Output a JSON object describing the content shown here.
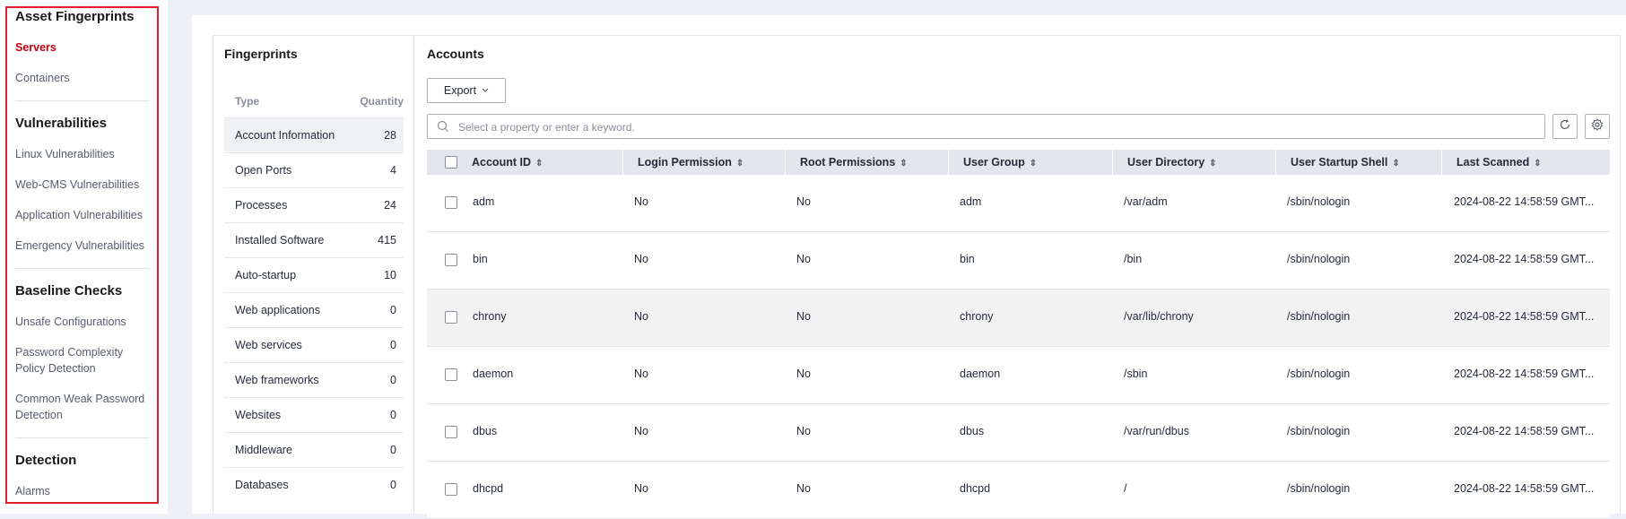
{
  "nav": {
    "groups": [
      {
        "title": "Asset Fingerprints",
        "items": [
          "Servers",
          "Containers"
        ]
      },
      {
        "title": "Vulnerabilities",
        "items": [
          "Linux Vulnerabilities",
          "Web-CMS Vulnerabilities",
          "Application Vulnerabilities",
          "Emergency Vulnerabilities"
        ]
      },
      {
        "title": "Baseline Checks",
        "items": [
          "Unsafe Configurations",
          "Password Complexity Policy Detection",
          "Common Weak Password Detection"
        ]
      },
      {
        "title": "Detection",
        "items": [
          "Alarms"
        ]
      }
    ],
    "active_item": "Servers",
    "highlight_color": "#e0202a"
  },
  "fingerprints": {
    "title": "Fingerprints",
    "col_type": "Type",
    "col_quantity": "Quantity",
    "rows": [
      {
        "type": "Account Information",
        "quantity": "28"
      },
      {
        "type": "Open Ports",
        "quantity": "4"
      },
      {
        "type": "Processes",
        "quantity": "24"
      },
      {
        "type": "Installed Software",
        "quantity": "415"
      },
      {
        "type": "Auto-startup",
        "quantity": "10"
      },
      {
        "type": "Web applications",
        "quantity": "0"
      },
      {
        "type": "Web services",
        "quantity": "0"
      },
      {
        "type": "Web frameworks",
        "quantity": "0"
      },
      {
        "type": "Websites",
        "quantity": "0"
      },
      {
        "type": "Middleware",
        "quantity": "0"
      },
      {
        "type": "Databases",
        "quantity": "0"
      }
    ],
    "selected": "Account Information"
  },
  "accounts": {
    "title": "Accounts",
    "export_label": "Export",
    "search_placeholder": "Select a property or enter a keyword.",
    "columns": [
      "Account ID",
      "Login Permission",
      "Root Permissions",
      "User Group",
      "User Directory",
      "User Startup Shell",
      "Last Scanned"
    ],
    "rows": [
      [
        "adm",
        "No",
        "No",
        "adm",
        "/var/adm",
        "/sbin/nologin",
        "2024-08-22 14:58:59 GMT..."
      ],
      [
        "bin",
        "No",
        "No",
        "bin",
        "/bin",
        "/sbin/nologin",
        "2024-08-22 14:58:59 GMT..."
      ],
      [
        "chrony",
        "No",
        "No",
        "chrony",
        "/var/lib/chrony",
        "/sbin/nologin",
        "2024-08-22 14:58:59 GMT..."
      ],
      [
        "daemon",
        "No",
        "No",
        "daemon",
        "/sbin",
        "/sbin/nologin",
        "2024-08-22 14:58:59 GMT..."
      ],
      [
        "dbus",
        "No",
        "No",
        "dbus",
        "/var/run/dbus",
        "/sbin/nologin",
        "2024-08-22 14:58:59 GMT..."
      ],
      [
        "dhcpd",
        "No",
        "No",
        "dhcpd",
        "/",
        "/sbin/nologin",
        "2024-08-22 14:58:59 GMT..."
      ]
    ],
    "hover_row": 2
  }
}
